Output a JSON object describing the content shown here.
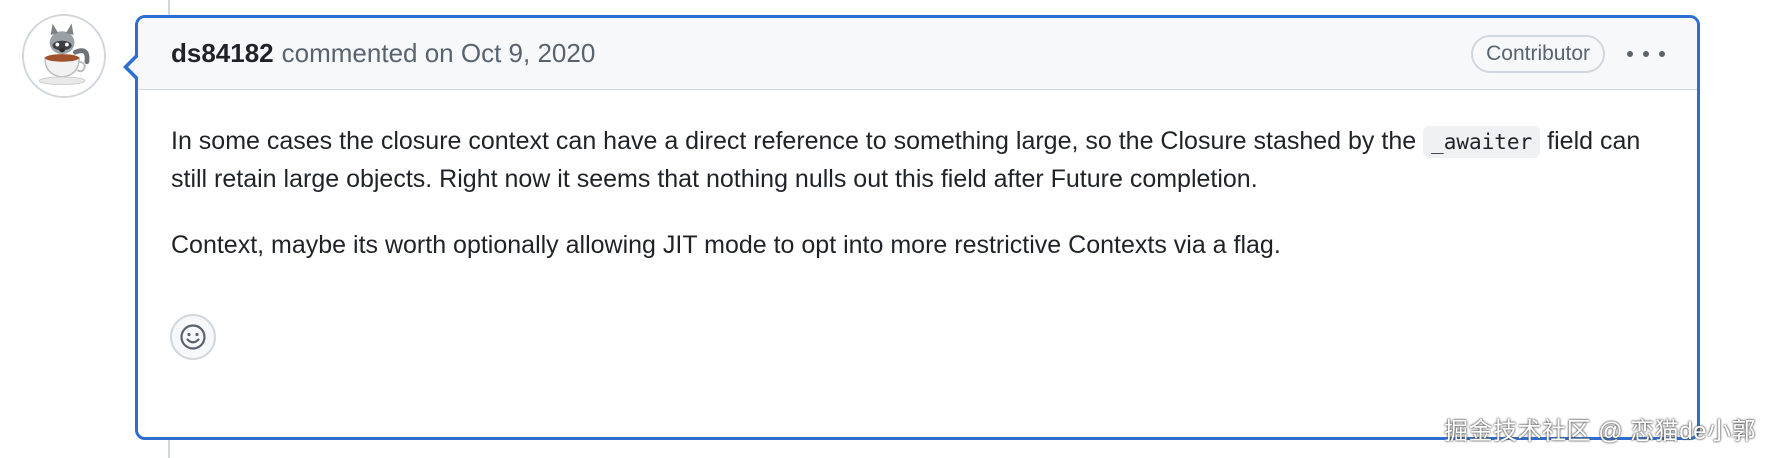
{
  "comment": {
    "author": "ds84182",
    "action_text": "commented on Oct 9, 2020",
    "role_badge": "Contributor",
    "body": {
      "p1_before_code": "In some cases the closure context can have a direct reference to something large, so the Closure stashed by the ",
      "p1_code": "_awaiter",
      "p1_after_code": " field can still retain large objects. Right now it seems that nothing nulls out this field after Future completion.",
      "p2": "Context, maybe its worth optionally allowing JIT mode to opt into more restrictive Contexts via a flag."
    }
  },
  "watermark": "掘金技术社区 @ 恋猫de小郭",
  "icons": {
    "menu": "kebab-horizontal-icon",
    "reaction": "smiley-icon",
    "avatar": "raccoon-in-teacup-avatar"
  },
  "colors": {
    "focus_border": "#2f6ed1",
    "header_bg": "#f6f8fa",
    "muted_text": "#59636e",
    "border": "#d0d7de"
  }
}
